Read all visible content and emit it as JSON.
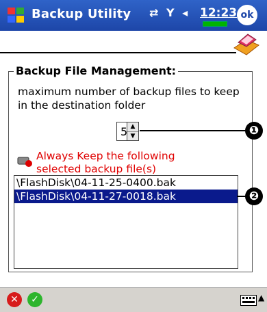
{
  "titlebar": {
    "title": "Backup Utility",
    "time": "12:23",
    "ok_label": "ok"
  },
  "group": {
    "title": "Backup File Management:",
    "description": "maximum number of backup files to keep in the destination folder",
    "max_files_value": "5"
  },
  "keep": {
    "label": "Always Keep the following selected backup file(s)"
  },
  "files": [
    {
      "name": "\\FlashDisk\\04-11-25-0400.bak",
      "selected": false
    },
    {
      "name": "\\FlashDisk\\04-11-27-0018.bak",
      "selected": true
    }
  ],
  "callouts": [
    "❶",
    "❷"
  ],
  "icons": [
    "windows-start-icon",
    "connectivity-icon",
    "signal-icon",
    "volume-icon",
    "ok-icon",
    "backup-utility-logo-icon",
    "keep-file-icon",
    "cancel-icon",
    "accept-icon",
    "keyboard-icon"
  ],
  "colors": {
    "titlebar": "#1d46a8",
    "selection": "#0a1a8c",
    "warning_text": "#e00000"
  }
}
